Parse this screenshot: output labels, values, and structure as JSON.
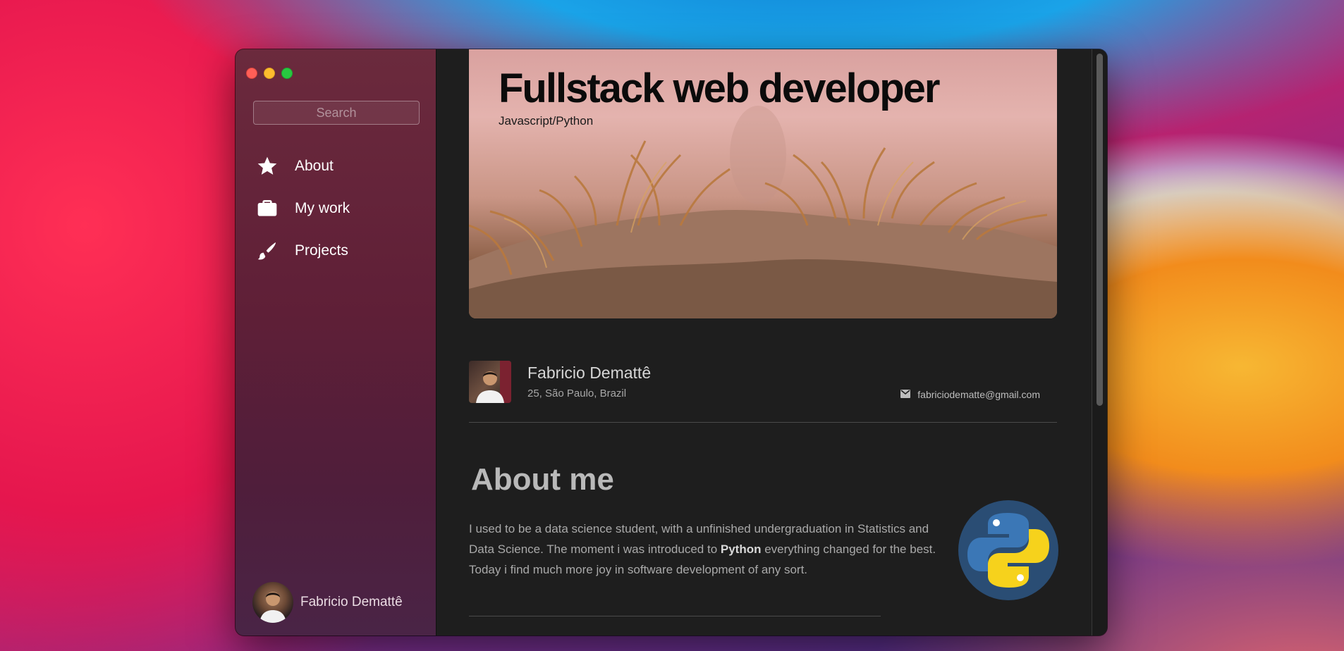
{
  "sidebar": {
    "search": {
      "placeholder": "Search"
    },
    "nav": [
      {
        "label": "About",
        "icon": "star-icon"
      },
      {
        "label": "My work",
        "icon": "briefcase-icon"
      },
      {
        "label": "Projects",
        "icon": "paintbrush-icon"
      }
    ],
    "user": {
      "name": "Fabricio Demattê"
    }
  },
  "hero": {
    "title": "Fullstack web developer",
    "subtitle": "Javascript/Python"
  },
  "profile": {
    "name": "Fabricio Demattê",
    "location": "25, São Paulo, Brazil",
    "email": "fabriciodematte@gmail.com"
  },
  "about": {
    "title": "About me",
    "text_before": "I used to be a data science student, with a unfinished undergraduation in Statistics and Data Science. The moment i was introduced to ",
    "highlight": "Python",
    "text_after": " everything changed for the best. Today i find much more joy in software development of any sort."
  },
  "colors": {
    "sidebar_top": "#6b2a3d",
    "content_bg": "#1e1e1e",
    "traffic_red": "#ff5f57",
    "traffic_yellow": "#febc2e",
    "traffic_green": "#28c840"
  }
}
